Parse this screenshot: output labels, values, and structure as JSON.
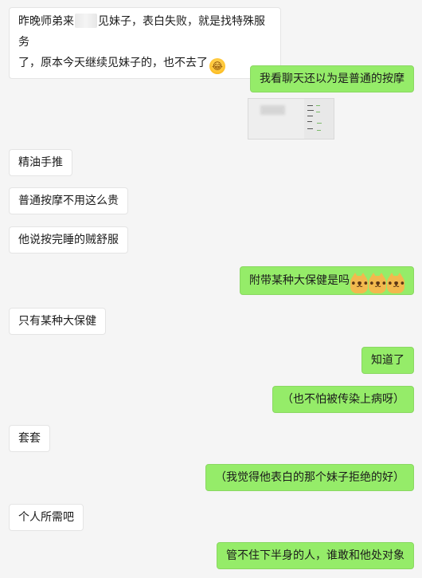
{
  "messages": [
    {
      "id": "m1",
      "side": "left",
      "line1_before": "昨晚师弟来",
      "line1_after": "见妹子，表白失败，就是找特殊服务",
      "line2": "了，原本今天继续见妹子的，也不去了",
      "emoji": "laugh-cry-emoji"
    },
    {
      "id": "m2",
      "side": "right",
      "text": "我看聊天还以为是普通的按摩"
    },
    {
      "id": "m3",
      "side": "right",
      "type": "image",
      "image_name": "chat-screenshot-thumbnail"
    },
    {
      "id": "m4",
      "side": "left",
      "text": "精油手推"
    },
    {
      "id": "m5",
      "side": "left",
      "text": "普通按摩不用这么贵"
    },
    {
      "id": "m6",
      "side": "left",
      "text": "他说按完睡的贼舒服"
    },
    {
      "id": "m7",
      "side": "right",
      "text": "附带某种大保健是吗",
      "emoji": [
        "dog-emoji",
        "dog-emoji",
        "dog-emoji"
      ]
    },
    {
      "id": "m8",
      "side": "left",
      "text": "只有某种大保健"
    },
    {
      "id": "m9",
      "side": "right",
      "text": "知道了"
    },
    {
      "id": "m10",
      "side": "right",
      "text": "（也不怕被传染上病呀）"
    },
    {
      "id": "m11",
      "side": "left",
      "text": "套套"
    },
    {
      "id": "m12",
      "side": "right",
      "text": "（我觉得他表白的那个妹子拒绝的好）"
    },
    {
      "id": "m13",
      "side": "left",
      "text": "个人所需吧"
    },
    {
      "id": "m14",
      "side": "right",
      "text": "管不住下半身的人，谁敢和他处对象"
    }
  ],
  "colors": {
    "background": "#f5f5f5",
    "incoming_bubble": "#ffffff",
    "outgoing_bubble": "#95ec69"
  }
}
